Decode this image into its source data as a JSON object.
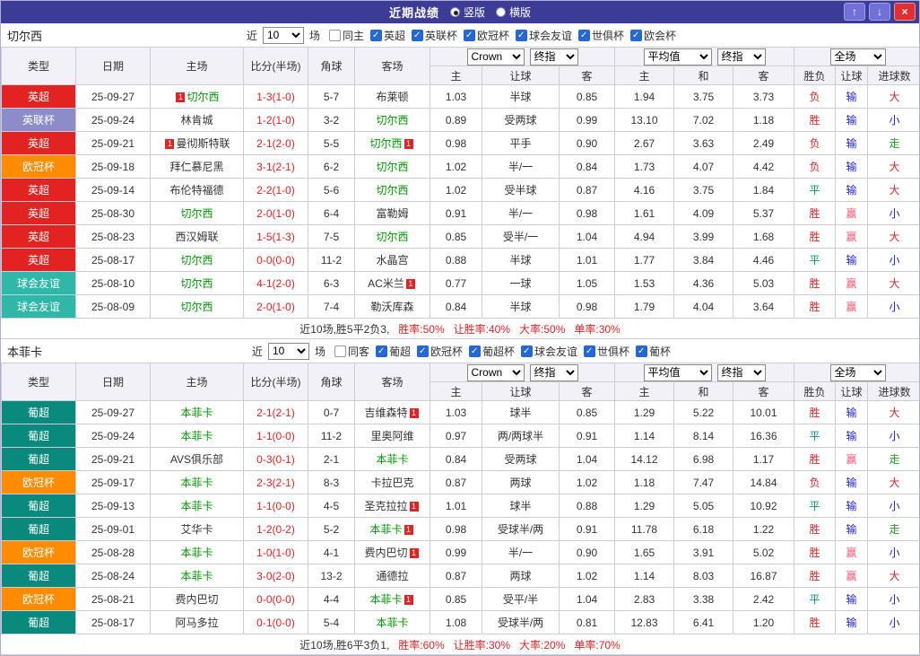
{
  "titlebar": {
    "title": "近期战绩",
    "radios": [
      {
        "label": "竖版",
        "checked": true
      },
      {
        "label": "横版",
        "checked": false
      }
    ],
    "buttons": {
      "up": "↑",
      "down": "↓",
      "close": "×"
    }
  },
  "filter_labels": {
    "near": "近",
    "games": "场"
  },
  "colors": {
    "accent_titlebar": "#3c3c96",
    "league_epl": "#e32222",
    "league_eflcup": "#8c8cc8",
    "league_ucl": "#ff8c00",
    "league_friendly": "#2eb8a8",
    "league_ppl": "#0a8a7c",
    "team_green": "#009900",
    "win_red": "#e32222",
    "lose_blue": "#2222dd",
    "draw_teal": "#00997a",
    "push_green": "#22a022",
    "cover_pink": "#ff5577"
  },
  "sections": [
    {
      "team": "切尔西",
      "filter": {
        "count": "10",
        "checkboxes": [
          {
            "label": "同主",
            "checked": false
          },
          {
            "label": "英超",
            "checked": true
          },
          {
            "label": "英联杯",
            "checked": true
          },
          {
            "label": "欧冠杯",
            "checked": true
          },
          {
            "label": "球会友谊",
            "checked": true
          },
          {
            "label": "世俱杯",
            "checked": true
          },
          {
            "label": "欧会杯",
            "checked": true
          }
        ]
      },
      "selects": {
        "bookmaker": "Crown",
        "bk_type": "终指",
        "avg": "平均值",
        "avg_type": "终指",
        "scope": "全场"
      },
      "headers": [
        "类型",
        "日期",
        "主场",
        "比分(半场)",
        "角球",
        "客场",
        "主",
        "让球",
        "客",
        "主",
        "和",
        "客",
        "胜负",
        "让球",
        "进球数"
      ],
      "rows": [
        {
          "league": "英超",
          "lg": "epl",
          "date": "25-09-27",
          "home": {
            "name": "切尔西",
            "team": true,
            "rb": "1"
          },
          "score": "1-3(1-0)",
          "corner": "5-7",
          "away": {
            "name": "布莱顿"
          },
          "ah": [
            "1.03",
            "半球",
            "0.85"
          ],
          "eu": [
            "1.94",
            "3.75",
            "3.73"
          ],
          "res": [
            [
              "负",
              "r"
            ],
            [
              "输",
              "b"
            ],
            [
              "大",
              "r"
            ]
          ]
        },
        {
          "league": "英联杯",
          "lg": "eflcup",
          "date": "25-09-24",
          "home": {
            "name": "林肯城"
          },
          "score": "1-2(1-0)",
          "corner": "3-2",
          "away": {
            "name": "切尔西",
            "team": true
          },
          "ah": [
            "0.89",
            "受两球",
            "0.99"
          ],
          "eu": [
            "13.10",
            "7.02",
            "1.18"
          ],
          "res": [
            [
              "胜",
              "r"
            ],
            [
              "输",
              "b"
            ],
            [
              "小",
              "b"
            ]
          ]
        },
        {
          "league": "英超",
          "lg": "epl",
          "date": "25-09-21",
          "home": {
            "name": "曼彻斯特联",
            "rb": "1"
          },
          "score": "2-1(2-0)",
          "corner": "5-5",
          "away": {
            "name": "切尔西",
            "team": true,
            "ra": "1"
          },
          "ah": [
            "0.98",
            "平手",
            "0.90"
          ],
          "eu": [
            "2.67",
            "3.63",
            "2.49"
          ],
          "res": [
            [
              "负",
              "r"
            ],
            [
              "输",
              "b"
            ],
            [
              "走",
              "g"
            ]
          ]
        },
        {
          "league": "欧冠杯",
          "lg": "ucl",
          "date": "25-09-18",
          "home": {
            "name": "拜仁慕尼黑"
          },
          "score": "3-1(2-1)",
          "corner": "6-2",
          "away": {
            "name": "切尔西",
            "team": true
          },
          "ah": [
            "1.02",
            "半/一",
            "0.84"
          ],
          "eu": [
            "1.73",
            "4.07",
            "4.42"
          ],
          "res": [
            [
              "负",
              "r"
            ],
            [
              "输",
              "b"
            ],
            [
              "大",
              "r"
            ]
          ]
        },
        {
          "league": "英超",
          "lg": "epl",
          "date": "25-09-14",
          "home": {
            "name": "布伦特福德"
          },
          "score": "2-2(1-0)",
          "corner": "5-6",
          "away": {
            "name": "切尔西",
            "team": true
          },
          "ah": [
            "1.02",
            "受半球",
            "0.87"
          ],
          "eu": [
            "4.16",
            "3.75",
            "1.84"
          ],
          "res": [
            [
              "平",
              "t"
            ],
            [
              "输",
              "b"
            ],
            [
              "大",
              "r"
            ]
          ]
        },
        {
          "league": "英超",
          "lg": "epl",
          "date": "25-08-30",
          "home": {
            "name": "切尔西",
            "team": true
          },
          "score": "2-0(1-0)",
          "corner": "6-4",
          "away": {
            "name": "富勒姆"
          },
          "ah": [
            "0.91",
            "半/一",
            "0.98"
          ],
          "eu": [
            "1.61",
            "4.09",
            "5.37"
          ],
          "res": [
            [
              "胜",
              "r"
            ],
            [
              "赢",
              "p"
            ],
            [
              "小",
              "b"
            ]
          ]
        },
        {
          "league": "英超",
          "lg": "epl",
          "date": "25-08-23",
          "home": {
            "name": "西汉姆联"
          },
          "score": "1-5(1-3)",
          "corner": "7-5",
          "away": {
            "name": "切尔西",
            "team": true
          },
          "ah": [
            "0.85",
            "受半/一",
            "1.04"
          ],
          "eu": [
            "4.94",
            "3.99",
            "1.68"
          ],
          "res": [
            [
              "胜",
              "r"
            ],
            [
              "赢",
              "p"
            ],
            [
              "大",
              "r"
            ]
          ]
        },
        {
          "league": "英超",
          "lg": "epl",
          "date": "25-08-17",
          "home": {
            "name": "切尔西",
            "team": true
          },
          "score": "0-0(0-0)",
          "corner": "11-2",
          "away": {
            "name": "水晶宫"
          },
          "ah": [
            "0.88",
            "半球",
            "1.01"
          ],
          "eu": [
            "1.77",
            "3.84",
            "4.46"
          ],
          "res": [
            [
              "平",
              "t"
            ],
            [
              "输",
              "b"
            ],
            [
              "小",
              "b"
            ]
          ]
        },
        {
          "league": "球会友谊",
          "lg": "friendly",
          "date": "25-08-10",
          "home": {
            "name": "切尔西",
            "team": true
          },
          "score": "4-1(2-0)",
          "corner": "6-3",
          "away": {
            "name": "AC米兰",
            "ra": "1"
          },
          "ah": [
            "0.77",
            "一球",
            "1.05"
          ],
          "eu": [
            "1.53",
            "4.36",
            "5.03"
          ],
          "res": [
            [
              "胜",
              "r"
            ],
            [
              "赢",
              "p"
            ],
            [
              "大",
              "r"
            ]
          ]
        },
        {
          "league": "球会友谊",
          "lg": "friendly",
          "date": "25-08-09",
          "home": {
            "name": "切尔西",
            "team": true
          },
          "score": "2-0(1-0)",
          "corner": "7-4",
          "away": {
            "name": "勒沃库森"
          },
          "ah": [
            "0.84",
            "半球",
            "0.98"
          ],
          "eu": [
            "1.79",
            "4.04",
            "3.64"
          ],
          "res": [
            [
              "胜",
              "r"
            ],
            [
              "赢",
              "p"
            ],
            [
              "小",
              "b"
            ]
          ]
        }
      ],
      "summary": {
        "prefix": "近10场,胜5平2负3,",
        "stats": [
          "胜率:50%",
          "让胜率:40%",
          "大率:50%",
          "单率:30%"
        ]
      }
    },
    {
      "team": "本菲卡",
      "filter": {
        "count": "10",
        "checkboxes": [
          {
            "label": "同客",
            "checked": false
          },
          {
            "label": "葡超",
            "checked": true
          },
          {
            "label": "欧冠杯",
            "checked": true
          },
          {
            "label": "葡超杯",
            "checked": true
          },
          {
            "label": "球会友谊",
            "checked": true
          },
          {
            "label": "世俱杯",
            "checked": true
          },
          {
            "label": "葡杯",
            "checked": true
          }
        ]
      },
      "selects": {
        "bookmaker": "Crown",
        "bk_type": "终指",
        "avg": "平均值",
        "avg_type": "终指",
        "scope": "全场"
      },
      "headers": [
        "类型",
        "日期",
        "主场",
        "比分(半场)",
        "角球",
        "客场",
        "主",
        "让球",
        "客",
        "主",
        "和",
        "客",
        "胜负",
        "让球",
        "进球数"
      ],
      "rows": [
        {
          "league": "葡超",
          "lg": "ppl",
          "date": "25-09-27",
          "home": {
            "name": "本菲卡",
            "team": true
          },
          "score": "2-1(2-1)",
          "corner": "0-7",
          "away": {
            "name": "吉维森特",
            "ra": "1"
          },
          "ah": [
            "1.03",
            "球半",
            "0.85"
          ],
          "eu": [
            "1.29",
            "5.22",
            "10.01"
          ],
          "res": [
            [
              "胜",
              "r"
            ],
            [
              "输",
              "b"
            ],
            [
              "大",
              "r"
            ]
          ]
        },
        {
          "league": "葡超",
          "lg": "ppl",
          "date": "25-09-24",
          "home": {
            "name": "本菲卡",
            "team": true
          },
          "score": "1-1(0-0)",
          "corner": "11-2",
          "away": {
            "name": "里奥阿维"
          },
          "ah": [
            "0.97",
            "两/两球半",
            "0.91"
          ],
          "eu": [
            "1.14",
            "8.14",
            "16.36"
          ],
          "res": [
            [
              "平",
              "t"
            ],
            [
              "输",
              "b"
            ],
            [
              "小",
              "b"
            ]
          ]
        },
        {
          "league": "葡超",
          "lg": "ppl",
          "date": "25-09-21",
          "home": {
            "name": "AVS俱乐部"
          },
          "score": "0-3(0-1)",
          "corner": "2-1",
          "away": {
            "name": "本菲卡",
            "team": true
          },
          "ah": [
            "0.84",
            "受两球",
            "1.04"
          ],
          "eu": [
            "14.12",
            "6.98",
            "1.17"
          ],
          "res": [
            [
              "胜",
              "r"
            ],
            [
              "赢",
              "p"
            ],
            [
              "走",
              "g"
            ]
          ]
        },
        {
          "league": "欧冠杯",
          "lg": "ucl",
          "date": "25-09-17",
          "home": {
            "name": "本菲卡",
            "team": true
          },
          "score": "2-3(2-1)",
          "corner": "8-3",
          "away": {
            "name": "卡拉巴克"
          },
          "ah": [
            "0.87",
            "两球",
            "1.02"
          ],
          "eu": [
            "1.18",
            "7.47",
            "14.84"
          ],
          "res": [
            [
              "负",
              "r"
            ],
            [
              "输",
              "b"
            ],
            [
              "大",
              "r"
            ]
          ]
        },
        {
          "league": "葡超",
          "lg": "ppl",
          "date": "25-09-13",
          "home": {
            "name": "本菲卡",
            "team": true
          },
          "score": "1-1(0-0)",
          "corner": "4-5",
          "away": {
            "name": "圣克拉拉",
            "ra": "1"
          },
          "ah": [
            "1.01",
            "球半",
            "0.88"
          ],
          "eu": [
            "1.29",
            "5.05",
            "10.92"
          ],
          "res": [
            [
              "平",
              "t"
            ],
            [
              "输",
              "b"
            ],
            [
              "小",
              "b"
            ]
          ]
        },
        {
          "league": "葡超",
          "lg": "ppl",
          "date": "25-09-01",
          "home": {
            "name": "艾华卡"
          },
          "score": "1-2(0-2)",
          "corner": "5-2",
          "away": {
            "name": "本菲卡",
            "team": true,
            "ra": "1"
          },
          "ah": [
            "0.98",
            "受球半/两",
            "0.91"
          ],
          "eu": [
            "11.78",
            "6.18",
            "1.22"
          ],
          "res": [
            [
              "胜",
              "r"
            ],
            [
              "输",
              "b"
            ],
            [
              "走",
              "g"
            ]
          ]
        },
        {
          "league": "欧冠杯",
          "lg": "ucl",
          "date": "25-08-28",
          "home": {
            "name": "本菲卡",
            "team": true
          },
          "score": "1-0(1-0)",
          "corner": "4-1",
          "away": {
            "name": "费内巴切",
            "ra": "1"
          },
          "ah": [
            "0.99",
            "半/一",
            "0.90"
          ],
          "eu": [
            "1.65",
            "3.91",
            "5.02"
          ],
          "res": [
            [
              "胜",
              "r"
            ],
            [
              "赢",
              "p"
            ],
            [
              "小",
              "b"
            ]
          ]
        },
        {
          "league": "葡超",
          "lg": "ppl",
          "date": "25-08-24",
          "home": {
            "name": "本菲卡",
            "team": true
          },
          "score": "3-0(2-0)",
          "corner": "13-2",
          "away": {
            "name": "通德拉"
          },
          "ah": [
            "0.87",
            "两球",
            "1.02"
          ],
          "eu": [
            "1.14",
            "8.03",
            "16.87"
          ],
          "res": [
            [
              "胜",
              "r"
            ],
            [
              "赢",
              "p"
            ],
            [
              "大",
              "r"
            ]
          ]
        },
        {
          "league": "欧冠杯",
          "lg": "ucl",
          "date": "25-08-21",
          "home": {
            "name": "费内巴切"
          },
          "score": "0-0(0-0)",
          "corner": "4-4",
          "away": {
            "name": "本菲卡",
            "team": true,
            "ra": "1"
          },
          "ah": [
            "0.85",
            "受平/半",
            "1.04"
          ],
          "eu": [
            "2.83",
            "3.38",
            "2.42"
          ],
          "res": [
            [
              "平",
              "t"
            ],
            [
              "输",
              "b"
            ],
            [
              "小",
              "b"
            ]
          ]
        },
        {
          "league": "葡超",
          "lg": "ppl",
          "date": "25-08-17",
          "home": {
            "name": "阿马多拉"
          },
          "score": "0-1(0-0)",
          "corner": "5-4",
          "away": {
            "name": "本菲卡",
            "team": true
          },
          "ah": [
            "1.08",
            "受球半/两",
            "0.81"
          ],
          "eu": [
            "12.83",
            "6.41",
            "1.20"
          ],
          "res": [
            [
              "胜",
              "r"
            ],
            [
              "输",
              "b"
            ],
            [
              "小",
              "b"
            ]
          ]
        }
      ],
      "summary": {
        "prefix": "近10场,胜6平3负1,",
        "stats": [
          "胜率:60%",
          "让胜率:30%",
          "大率:20%",
          "单率:70%"
        ]
      }
    }
  ]
}
